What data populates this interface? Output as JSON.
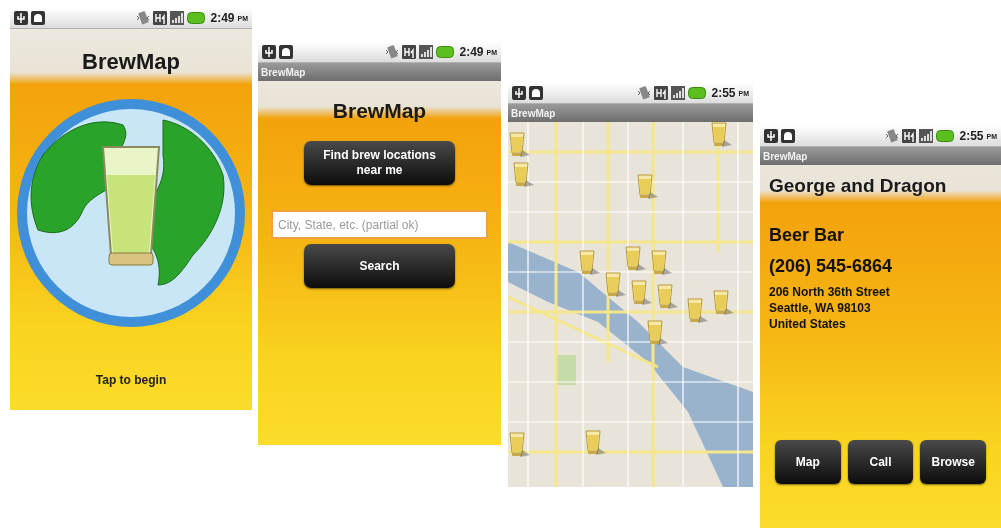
{
  "screens": [
    {
      "kind": "splash",
      "status_bar": {
        "time": "2:49",
        "period": "PM"
      },
      "app_title": "BrewMap",
      "caption": "Tap to begin"
    },
    {
      "kind": "search",
      "status_bar": {
        "time": "2:49",
        "period": "PM"
      },
      "title_bar": "BrewMap",
      "app_title": "BrewMap",
      "find_button": "Find brew locations near me",
      "search_field": {
        "placeholder": "City, State, etc. (partial ok)"
      },
      "search_button": "Search"
    },
    {
      "kind": "map",
      "status_bar": {
        "time": "2:55",
        "period": "PM"
      },
      "title_bar": "BrewMap"
    },
    {
      "kind": "detail",
      "status_bar": {
        "time": "2:55",
        "period": "PM"
      },
      "title_bar": "BrewMap",
      "venue_name": "George and Dragon",
      "venue_type": "Beer Bar",
      "phone": "(206) 545-6864",
      "address": [
        "206 North 36th Street",
        "Seattle, WA 98103",
        "United States"
      ],
      "buttons": [
        "Map",
        "Call",
        "Browse"
      ]
    }
  ]
}
